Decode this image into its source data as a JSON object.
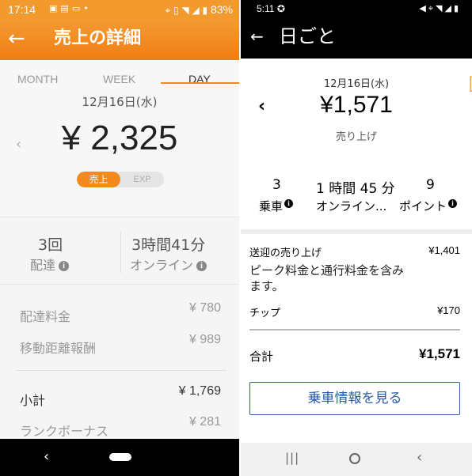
{
  "left": {
    "status_bar": {
      "time": "17:14",
      "battery": "83%",
      "icons": [
        "image-icon",
        "news-icon",
        "cast-icon",
        "dot-icon",
        "location-icon",
        "vibrate-icon",
        "wifi-icon",
        "signal-icon",
        "battery-icon"
      ]
    },
    "app_bar": {
      "back_glyph": "←",
      "title": "売上の詳細"
    },
    "tabs": [
      {
        "label": "MONTH",
        "active": false
      },
      {
        "label": "WEEK",
        "active": false
      },
      {
        "label": "DAY",
        "active": true
      }
    ],
    "summary": {
      "date": "12月16日(水)",
      "prev_glyph": "‹",
      "amount": "¥ 2,325",
      "toggle": {
        "selected": "売上",
        "other": "EXP"
      }
    },
    "stats": [
      {
        "value": "3回",
        "label": "配達"
      },
      {
        "value": "3時間41分",
        "label": "オンライン"
      }
    ],
    "breakdown": [
      {
        "label": "配達料金",
        "value": "¥ 780"
      },
      {
        "label": "移動距離報酬",
        "value": "¥ 989"
      }
    ],
    "subtotal": {
      "label": "小計",
      "value": "¥ 1,769"
    },
    "bonus": {
      "label": "ランクボーナス",
      "value": "¥ 281"
    },
    "nav_bar": {
      "back_glyph": "‹"
    },
    "accent_color": "#f28a1e"
  },
  "right": {
    "status_bar": {
      "time": "5:11",
      "icons": [
        "app-icon",
        "mute-icon",
        "location-icon",
        "wifi-icon",
        "signal-icon",
        "battery-icon"
      ]
    },
    "app_bar": {
      "back_glyph": "←",
      "title": "日ごと"
    },
    "summary": {
      "date": "12月16日(水)",
      "prev_glyph": "‹",
      "amount": "¥1,571",
      "amount_label": "売り上げ"
    },
    "stats": [
      {
        "value": "3",
        "label": "乗車"
      },
      {
        "value": "1 時間 45 分",
        "label": "オンライン..."
      },
      {
        "value": "9",
        "label": "ポイント"
      }
    ],
    "fare": {
      "label": "送迎の売り上げ",
      "value": "¥1,401"
    },
    "fare_note": "ピーク料金と通行料金を含みます。",
    "tip": {
      "label": "チップ",
      "value": "¥170"
    },
    "total": {
      "label": "合計",
      "value": "¥1,571"
    },
    "view_trips_button": "乗車情報を見る",
    "nav_bar": {
      "recent_glyph": "|||",
      "back_glyph": "‹"
    },
    "accent_color": "#2a5aa5"
  }
}
